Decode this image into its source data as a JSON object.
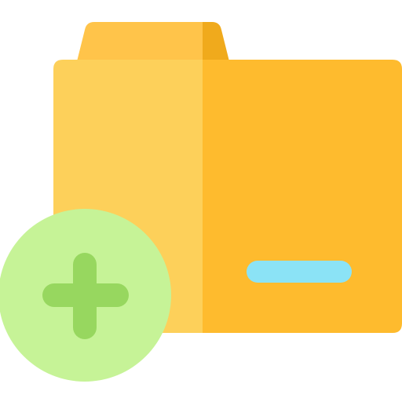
{
  "icon": {
    "name": "add-folder-icon",
    "colors": {
      "folder_tab_left": "#FFC44A",
      "folder_tab_right": "#F0AA1C",
      "folder_front_left": "#FDD05A",
      "folder_front_right": "#FEBB2E",
      "label_slot": "#8BE3F6",
      "plus_badge_bg": "#C6F397",
      "plus_sign": "#97D75F",
      "background": "#FFFFFF"
    }
  }
}
